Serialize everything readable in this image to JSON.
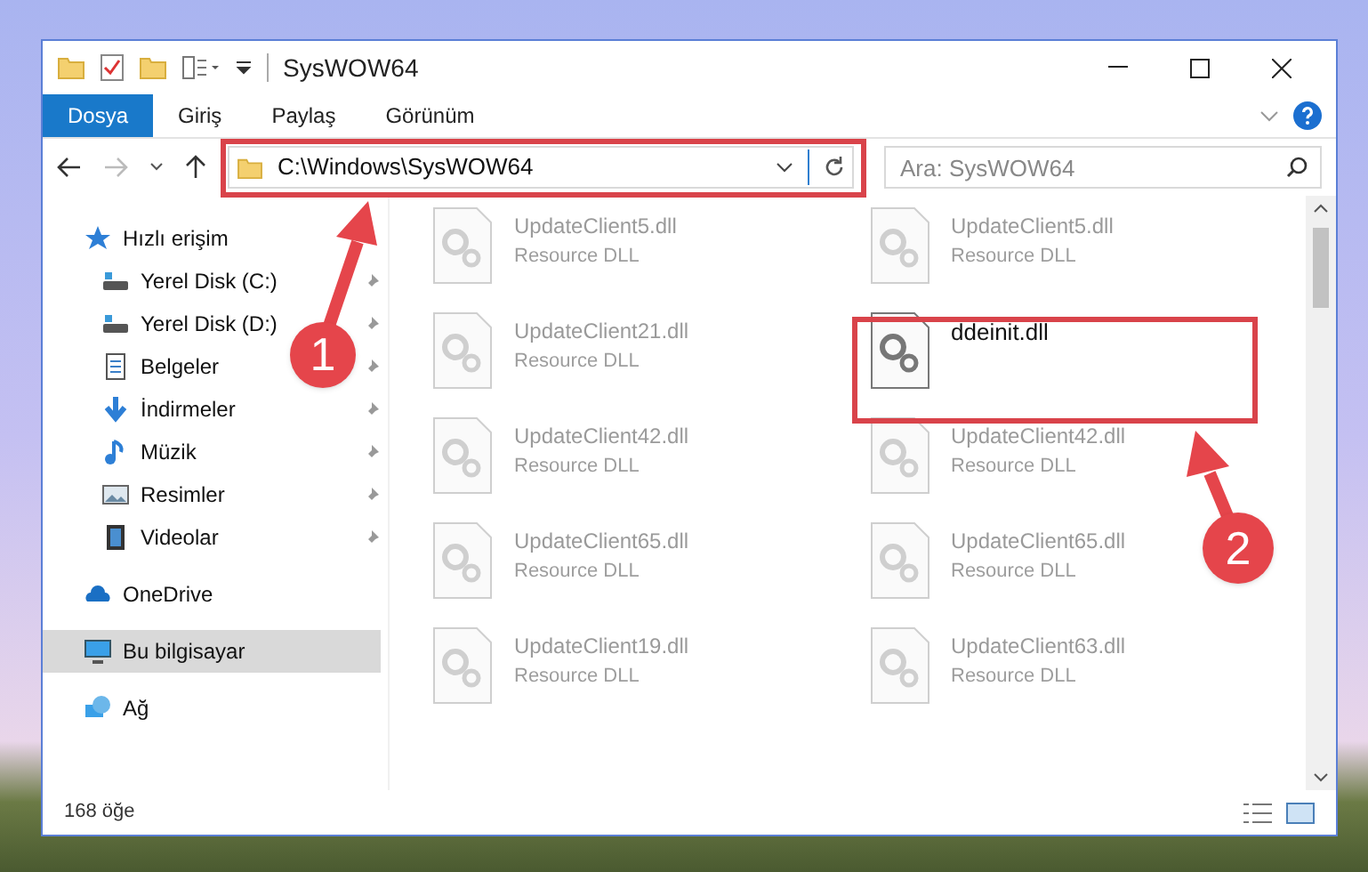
{
  "window": {
    "title": "SysWOW64"
  },
  "ribbon_tabs": [
    {
      "label": "Dosya",
      "selected": true
    },
    {
      "label": "Giriş",
      "selected": false
    },
    {
      "label": "Paylaş",
      "selected": false
    },
    {
      "label": "Görünüm",
      "selected": false
    }
  ],
  "address_bar": {
    "path": "C:\\Windows\\SysWOW64"
  },
  "search": {
    "placeholder": "Ara: SysWOW64"
  },
  "sidebar": {
    "items": [
      {
        "label": "Hızlı erişim",
        "selected": false,
        "children": [
          {
            "label": "Yerel Disk (C:)",
            "pinned": true,
            "selected": false
          },
          {
            "label": "Yerel Disk (D:)",
            "pinned": true,
            "selected": false
          },
          {
            "label": "Belgeler",
            "pinned": true,
            "selected": false
          },
          {
            "label": "İndirmeler",
            "pinned": true,
            "selected": false
          },
          {
            "label": "Müzik",
            "pinned": true,
            "selected": false
          },
          {
            "label": "Resimler",
            "pinned": true,
            "selected": false
          },
          {
            "label": "Videolar",
            "pinned": true,
            "selected": false
          }
        ]
      },
      {
        "label": "OneDrive",
        "selected": false
      },
      {
        "label": "Bu bilgisayar",
        "selected": true
      },
      {
        "label": "Ağ",
        "selected": false
      }
    ]
  },
  "files": [
    {
      "name": "UpdateClient5.dll",
      "type": "Resource DLL",
      "faded": true
    },
    {
      "name": "UpdateClient5.dll",
      "type": "Resource DLL",
      "faded": true
    },
    {
      "name": "UpdateClient21.dll",
      "type": "Resource DLL",
      "faded": true
    },
    {
      "name": "ddeinit.dll",
      "faded": false
    },
    {
      "name": "UpdateClient42.dll",
      "type": "Resource DLL",
      "faded": true
    },
    {
      "name": "UpdateClient42.dll",
      "type": "Resource DLL",
      "faded": true
    },
    {
      "name": "UpdateClient65.dll",
      "type": "Resource DLL",
      "faded": true
    },
    {
      "name": "UpdateClient65.dll",
      "type": "Resource DLL",
      "faded": true
    },
    {
      "name": "UpdateClient19.dll",
      "type": "Resource DLL",
      "faded": true
    },
    {
      "name": "UpdateClient63.dll",
      "type": "Resource DLL",
      "faded": true
    }
  ],
  "status_bar": {
    "item_count": "168 öğe"
  },
  "callouts": [
    {
      "number": "1"
    },
    {
      "number": "2"
    }
  ]
}
